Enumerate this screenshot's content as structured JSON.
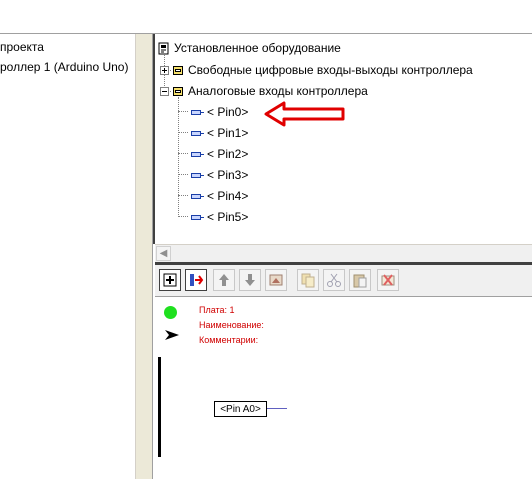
{
  "project_tree": {
    "items": [
      {
        "label": "проекта"
      },
      {
        "label": "роллер 1 (Arduino Uno)"
      }
    ]
  },
  "hardware_tree": {
    "root": {
      "label": "Установленное оборудование"
    },
    "groups": [
      {
        "label": "Свободные цифровые входы-выходы контроллера",
        "expanded": false
      },
      {
        "label": "Аналоговые входы контроллера",
        "expanded": true
      }
    ],
    "pins": [
      "< Pin0>",
      "< Pin1>",
      "< Pin2>",
      "< Pin3>",
      "< Pin4>",
      "< Pin5>"
    ],
    "highlighted_pin": "< Pin0>",
    "icons": {
      "group": "folder-icon",
      "pin": "pin-icon"
    }
  },
  "toolbar": {
    "buttons": [
      {
        "icon": "board-add-icon",
        "active": true
      },
      {
        "icon": "pin-connect-icon",
        "active": true
      },
      {
        "icon": "move-up-icon",
        "active": false
      },
      {
        "icon": "move-down-icon",
        "active": false
      },
      {
        "icon": "image-icon",
        "active": false
      },
      {
        "icon": "copy-icon",
        "active": false
      },
      {
        "icon": "cut-icon",
        "active": false
      },
      {
        "icon": "paste-icon",
        "active": false
      },
      {
        "icon": "delete-icon",
        "active": false
      }
    ]
  },
  "editor": {
    "board_line": "Плата: 1",
    "name_line": "Наименование:",
    "comment_line": "Комментарии:",
    "pin_label": "<Pin A0>",
    "colors": {
      "info_text": "#d00000",
      "status_dot": "#1fe01f",
      "annotation_arrow": "#e00000"
    }
  }
}
